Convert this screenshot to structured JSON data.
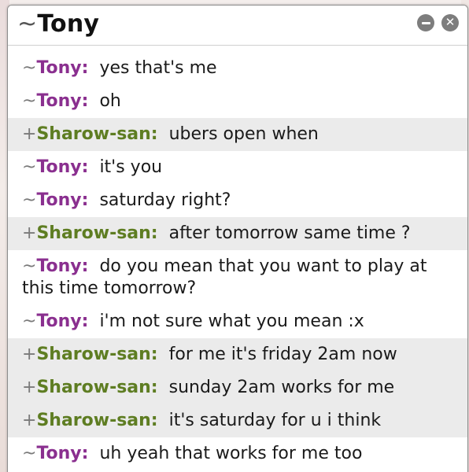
{
  "window": {
    "prefix": "~",
    "title": "Tony",
    "minimize_icon": "minimize-icon",
    "close_icon": "close-icon"
  },
  "colors": {
    "tony_nick": "#8a2f8f",
    "sharow_nick": "#5e7d22",
    "alt_row": "#ebebeb"
  },
  "messages": [
    {
      "prefix": "~",
      "nick": "Tony:",
      "text": "yes that's me",
      "who": "tony"
    },
    {
      "prefix": "~",
      "nick": "Tony:",
      "text": "oh",
      "who": "tony"
    },
    {
      "prefix": "+",
      "nick": "Sharow-san:",
      "text": "ubers open when",
      "who": "sharow"
    },
    {
      "prefix": "~",
      "nick": "Tony:",
      "text": "it's you",
      "who": "tony"
    },
    {
      "prefix": "~",
      "nick": "Tony:",
      "text": "saturday right?",
      "who": "tony"
    },
    {
      "prefix": "+",
      "nick": "Sharow-san:",
      "text": "after tomorrow same time ?",
      "who": "sharow"
    },
    {
      "prefix": "~",
      "nick": "Tony:",
      "text": "do you mean that you want to play at this time tomorrow?",
      "who": "tony"
    },
    {
      "prefix": "~",
      "nick": "Tony:",
      "text": "i'm not sure what you mean :x",
      "who": "tony"
    },
    {
      "prefix": "+",
      "nick": "Sharow-san:",
      "text": "for me it's friday 2am now",
      "who": "sharow"
    },
    {
      "prefix": "+",
      "nick": "Sharow-san:",
      "text": "sunday 2am works for me",
      "who": "sharow"
    },
    {
      "prefix": "+",
      "nick": "Sharow-san:",
      "text": "it's saturday for u i think",
      "who": "sharow"
    },
    {
      "prefix": "~",
      "nick": "Tony:",
      "text": "uh yeah that works for me too",
      "who": "tony"
    }
  ]
}
